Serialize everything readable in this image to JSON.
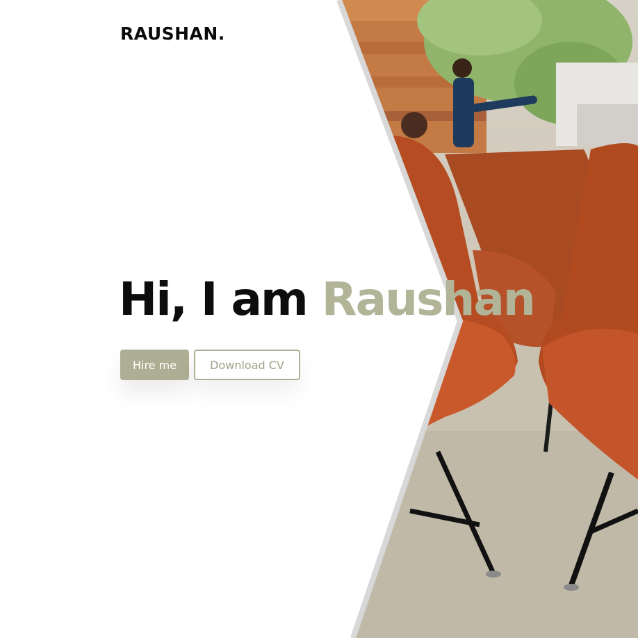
{
  "header": {
    "logo": "RAUSHAN."
  },
  "hero": {
    "greeting": "Hi, I am",
    "name": "Raushan",
    "hire_button": "Hire me",
    "cv_button": "Download CV"
  },
  "colors": {
    "accent": "#adae93",
    "text": "#0d0d0d",
    "background": "#ffffff"
  }
}
